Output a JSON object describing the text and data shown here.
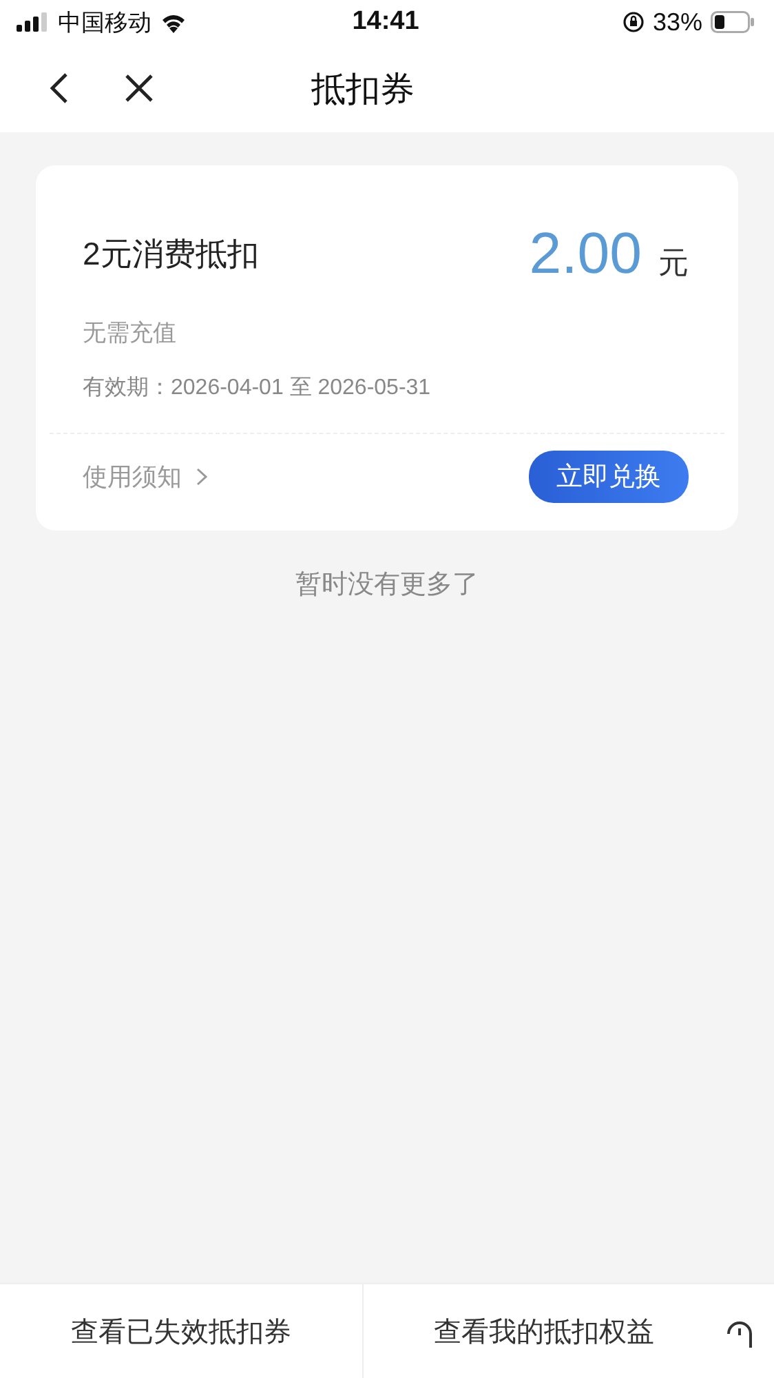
{
  "status_bar": {
    "carrier": "中国移动",
    "time": "14:41",
    "battery": "33%"
  },
  "nav": {
    "title": "抵扣券"
  },
  "coupons": [
    {
      "name": "2元消费抵扣",
      "amount": "2.00",
      "unit": "元",
      "note": "无需充值",
      "validity": "有效期：2026-04-01 至 2026-05-31",
      "rules_link": "使用须知",
      "action": "立即兑换"
    }
  ],
  "end_text": "暂时没有更多了",
  "bottom_bar": {
    "buttons": [
      "查看已失效抵扣券",
      "查看我的抵扣权益"
    ]
  }
}
